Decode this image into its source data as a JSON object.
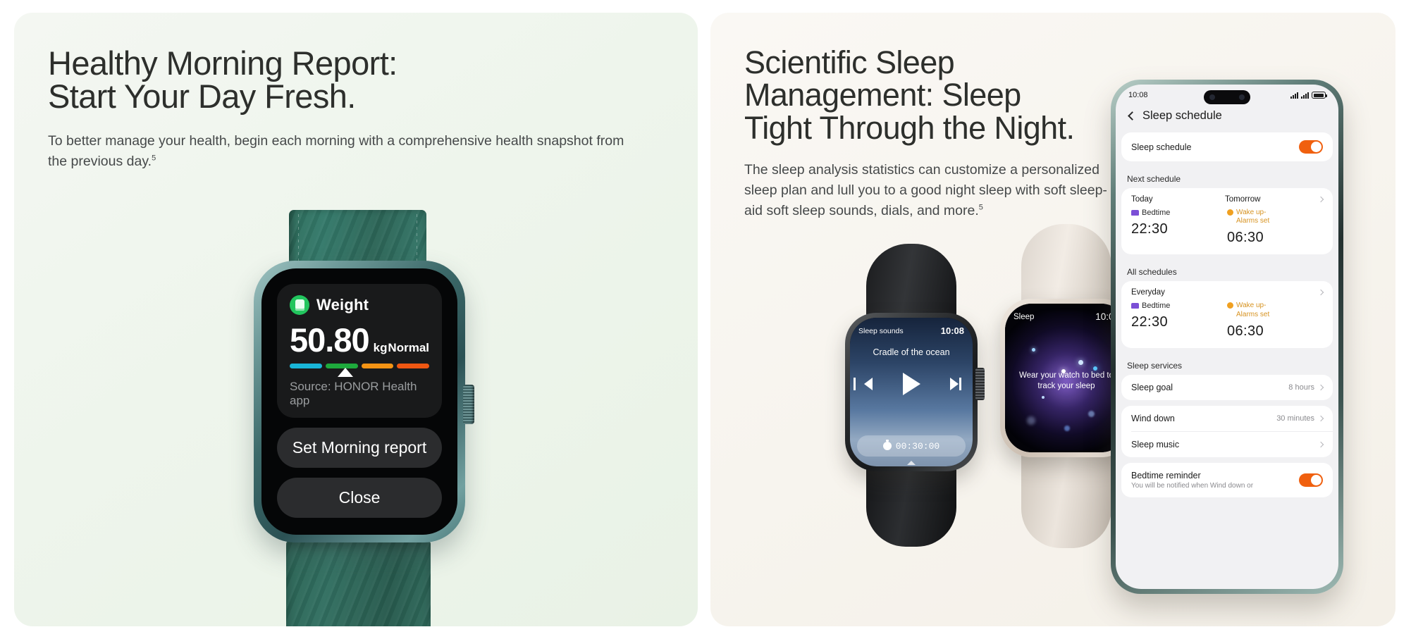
{
  "left_panel": {
    "headline": "Healthy Morning Report:\nStart Your Day Fresh.",
    "subcopy": "To better manage your health, begin each morning with a comprehensive health snapshot from the previous day.",
    "footnote": "5",
    "watch": {
      "card_title": "Weight",
      "card_icon": "scale-icon",
      "value": "50.80",
      "unit": "kg",
      "status": "Normal",
      "source": "Source: HONOR Health app",
      "range_colors": [
        "#19b6d8",
        "#1eaa3c",
        "#f59414",
        "#ef5712"
      ],
      "marker_position_pct": 34.5,
      "buttons": [
        "Set Morning report",
        "Close"
      ]
    }
  },
  "right_panel": {
    "headline": "Scientific Sleep\nManagement: Sleep\nTight Through the Night.",
    "subcopy": "The sleep analysis statistics can customize a personalized sleep plan and lull you to a good night sleep with soft sleep-aid soft sleep sounds, dials, and more.",
    "footnote": "5",
    "watch_black": {
      "app_label": "Sleep sounds",
      "time": "10:08",
      "track_title": "Cradle of the ocean",
      "timer": "00:30:00",
      "controls": [
        "previous-track",
        "play",
        "next-track"
      ]
    },
    "watch_cream": {
      "app_label": "Sleep",
      "time": "10:08",
      "message": "Wear your watch to bed to\ntrack your sleep"
    },
    "phone": {
      "status_time": "10:08",
      "nav_title": "Sleep schedule",
      "rows": {
        "sleep_schedule_label": "Sleep schedule",
        "sleep_schedule_toggle": "on",
        "next_schedule_title": "Next schedule",
        "all_schedules_title": "All schedules",
        "sleep_services_title": "Sleep services"
      },
      "next_schedule": {
        "left_day": "Today",
        "left_kind": "Bedtime",
        "left_time": "22:30",
        "right_day": "Tomorrow",
        "right_kind": "Wake up-\nAlarms set",
        "right_time": "06:30"
      },
      "all_schedules": {
        "day": "Everyday",
        "left_kind": "Bedtime",
        "left_time": "22:30",
        "right_kind": "Wake up-\nAlarms set",
        "right_time": "06:30"
      },
      "services": [
        {
          "label": "Sleep goal",
          "value": "8 hours"
        },
        {
          "label": "Wind down",
          "value": "30 minutes"
        },
        {
          "label": "Sleep music",
          "value": ""
        }
      ],
      "bedtime_reminder": {
        "label": "Bedtime reminder",
        "description": "You will be notified when Wind down or",
        "toggle": "on"
      },
      "accent_color": "#f0600f"
    }
  }
}
